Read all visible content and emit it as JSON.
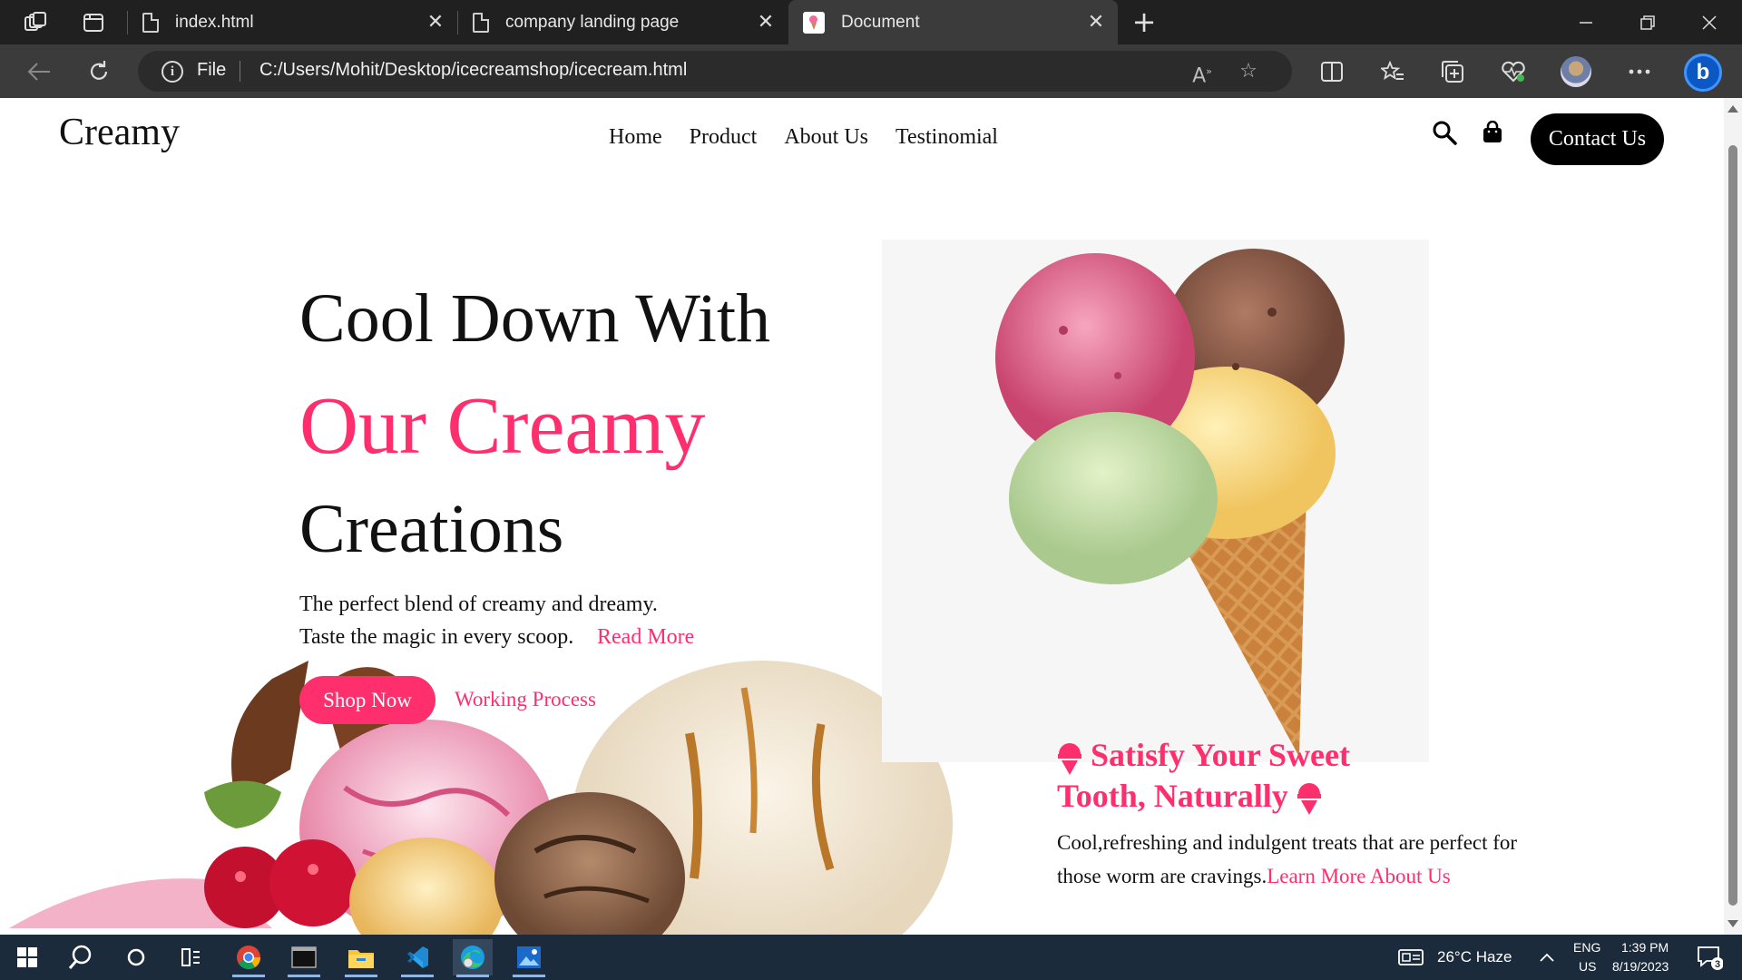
{
  "browser": {
    "tabs": [
      {
        "title": "index.html"
      },
      {
        "title": "company landing page"
      },
      {
        "title": "Document"
      }
    ],
    "address": {
      "scheme_label": "File",
      "url": "C:/Users/Mohit/Desktop/icecreamshop/icecream.html"
    }
  },
  "site": {
    "logo": "Creamy",
    "nav": [
      "Home",
      "Product",
      "About Us",
      "Testinomial"
    ],
    "contact_label": "Contact Us",
    "hero": {
      "line1": "Cool Down With",
      "line2": "Our Creamy",
      "line3": "Creations",
      "para_line1": "The perfect blend of creamy and dreamy.",
      "para_line2": "Taste the magic in every scoop.",
      "read_more": "Read More",
      "shop_now": "Shop Now",
      "working_process": "Working Process"
    },
    "feature": {
      "title_part1": "Satisfy Your Sweet",
      "title_part2": "Tooth, Naturally",
      "text": "Cool,refreshing and indulgent treats that are perfect for those worm are cravings.",
      "link": "Learn More About Us"
    },
    "accent_color": "#ff2f6e"
  },
  "taskbar": {
    "weather": "26°C  Haze",
    "lang_top": "ENG",
    "lang_bottom": "US",
    "time": "1:39 PM",
    "date": "8/19/2023",
    "notifications": "3"
  }
}
